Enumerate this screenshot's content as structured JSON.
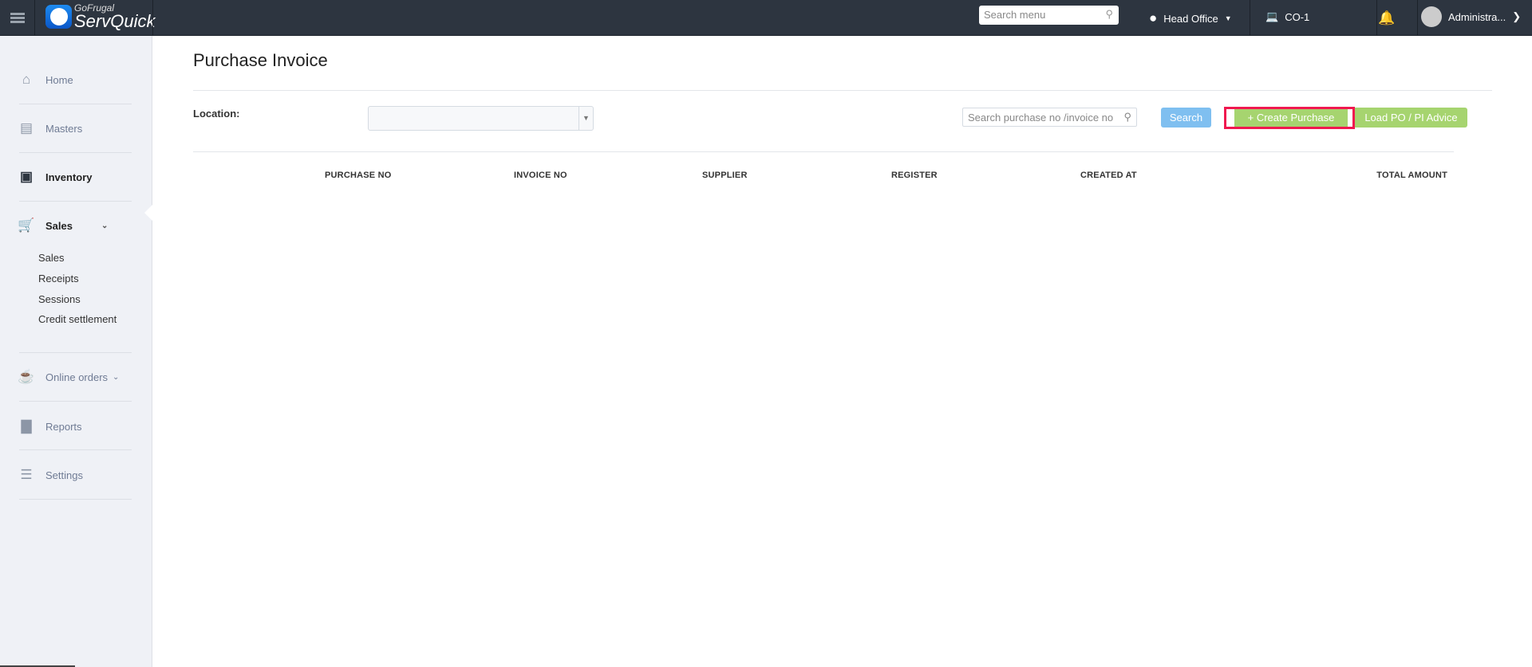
{
  "header": {
    "logo_top": "GoFrugal",
    "logo_bottom": "ServQuick",
    "search_placeholder": "Search menu",
    "location": "Head Office",
    "register": "CO-1",
    "user": "Administra..."
  },
  "sidebar": {
    "items": [
      {
        "label": "Home"
      },
      {
        "label": "Masters"
      },
      {
        "label": "Inventory"
      },
      {
        "label": "Sales"
      },
      {
        "label": "Online orders"
      },
      {
        "label": "Reports"
      },
      {
        "label": "Settings"
      }
    ],
    "sales_sub": [
      "Sales",
      "Receipts",
      "Sessions",
      "Credit settlement"
    ]
  },
  "page": {
    "title": "Purchase Invoice",
    "location_label": "Location:",
    "location_value": "",
    "search_placeholder": "Search purchase no /invoice no",
    "search_btn": "Search",
    "create_btn": "+ Create Purchase",
    "load_btn": "Load PO / PI Advice",
    "columns": [
      "PURCHASE NO",
      "INVOICE NO",
      "SUPPLIER",
      "REGISTER",
      "CREATED AT",
      "TOTAL AMOUNT"
    ]
  },
  "colors": {
    "header": "#2d3540",
    "green": "#a6d46f",
    "blue": "#7fbff0",
    "highlight": "#f0184f"
  }
}
